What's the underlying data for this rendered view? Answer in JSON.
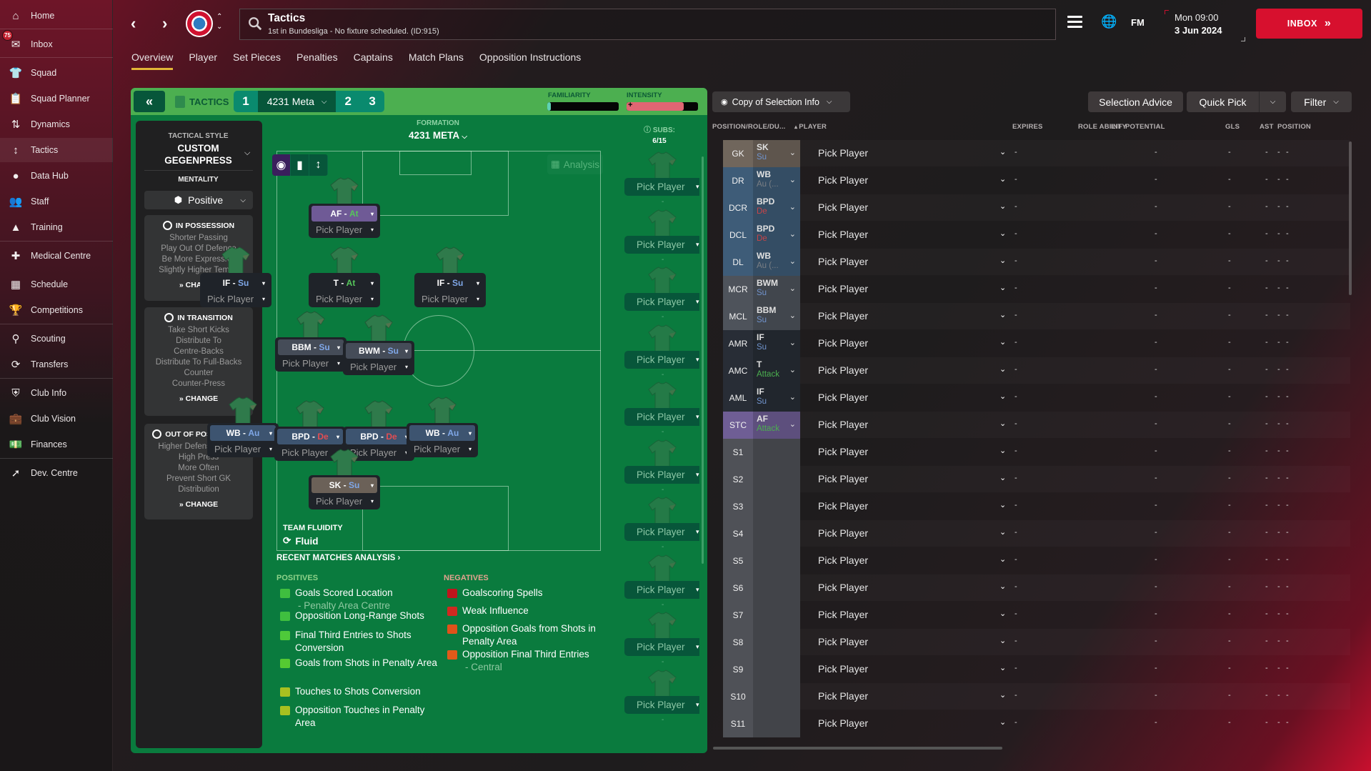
{
  "sidebar": {
    "items": [
      {
        "label": "Home",
        "icon": "home-icon"
      },
      {
        "label": "Inbox",
        "icon": "inbox-icon",
        "badge": "75"
      },
      {
        "label": "Squad",
        "icon": "shirt-icon"
      },
      {
        "label": "Squad Planner",
        "icon": "clipboard-icon"
      },
      {
        "label": "Dynamics",
        "icon": "dynamics-icon"
      },
      {
        "label": "Tactics",
        "icon": "tactics-icon",
        "active": true
      },
      {
        "label": "Data Hub",
        "icon": "data-hub-icon"
      },
      {
        "label": "Staff",
        "icon": "staff-icon"
      },
      {
        "label": "Training",
        "icon": "training-icon"
      },
      {
        "label": "Medical Centre",
        "icon": "medical-icon"
      },
      {
        "label": "Schedule",
        "icon": "calendar-icon"
      },
      {
        "label": "Competitions",
        "icon": "trophy-icon"
      },
      {
        "label": "Scouting",
        "icon": "search-icon"
      },
      {
        "label": "Transfers",
        "icon": "transfer-icon"
      },
      {
        "label": "Club Info",
        "icon": "shield-icon"
      },
      {
        "label": "Club Vision",
        "icon": "briefcase-icon"
      },
      {
        "label": "Finances",
        "icon": "money-icon"
      },
      {
        "label": "Dev. Centre",
        "icon": "growth-icon"
      }
    ]
  },
  "header": {
    "title": "Tactics",
    "subtitle": "1st in Bundesliga - No fixture scheduled. (ID:915)",
    "fm_label": "FM",
    "date_time": "Mon 09:00",
    "date": "3 Jun 2024",
    "inbox_label": "INBOX"
  },
  "tabs": [
    "Overview",
    "Player",
    "Set Pieces",
    "Penalties",
    "Captains",
    "Match Plans",
    "Opposition Instructions"
  ],
  "tactics_bar": {
    "label": "TACTICS",
    "slots": [
      "1",
      "2",
      "3"
    ],
    "active_tactic": "4231 Meta",
    "familiarity_label": "FAMILIARITY",
    "familiarity_value": 0.05,
    "intensity_label": "INTENSITY",
    "intensity_value": 0.8
  },
  "style": {
    "caption": "TACTICAL STYLE",
    "name_line1": "CUSTOM",
    "name_line2": "GEGENPRESS",
    "mentality_caption": "MENTALITY",
    "mentality": "Positive",
    "change_label": "CHANGE",
    "in_possession": {
      "title": "IN POSSESSION",
      "lines": [
        "Shorter Passing",
        "Play Out Of Defence",
        "Be More Expressive",
        "Slightly Higher Tempo"
      ]
    },
    "in_transition": {
      "title": "IN TRANSITION",
      "lines": [
        "Take Short Kicks",
        "Distribute To",
        "Centre-Backs",
        "Distribute To Full-Backs",
        "Counter",
        "Counter-Press"
      ]
    },
    "out_of_possession": {
      "title": "OUT OF POSSESSION",
      "lines": [
        "Higher Defensive Line",
        "High Press",
        "More Often",
        "Prevent Short GK",
        "Distribution"
      ]
    }
  },
  "pitch": {
    "formation_caption": "FORMATION",
    "formation": "4231 META",
    "subs_caption": "SUBS:",
    "subs_count": "6/15",
    "analysis_label": "Analysis",
    "pick_label": "Pick Player",
    "fluidity_caption": "TEAM FLUIDITY",
    "fluidity": "Fluid",
    "players": [
      {
        "role": "AF",
        "duty": "At",
        "duty_class": "at",
        "color": "#6f5a96"
      },
      {
        "role": "IF",
        "duty": "Su",
        "duty_class": "su",
        "color": "#1f2329"
      },
      {
        "role": "T",
        "duty": "At",
        "duty_class": "at",
        "color": "#1f2329"
      },
      {
        "role": "IF",
        "duty": "Su",
        "duty_class": "su",
        "color": "#1f2329"
      },
      {
        "role": "BBM",
        "duty": "Su",
        "duty_class": "su",
        "color": "#454c58"
      },
      {
        "role": "BWM",
        "duty": "Su",
        "duty_class": "su",
        "color": "#454c58"
      },
      {
        "role": "WB",
        "duty": "Au",
        "duty_class": "au",
        "color": "#3d5470"
      },
      {
        "role": "BPD",
        "duty": "De",
        "duty_class": "de",
        "color": "#3d5470"
      },
      {
        "role": "BPD",
        "duty": "De",
        "duty_class": "de",
        "color": "#3d5470"
      },
      {
        "role": "WB",
        "duty": "Au",
        "duty_class": "au",
        "color": "#3d5470"
      },
      {
        "role": "SK",
        "duty": "Su",
        "duty_class": "su",
        "color": "#6b6158"
      }
    ],
    "sub_slots": 10,
    "sub_dash": "-"
  },
  "recent_matches": {
    "title": "RECENT MATCHES ANALYSIS",
    "positives_label": "POSITIVES",
    "negatives_label": "NEGATIVES",
    "positives": [
      {
        "text": "Goals Scored Location",
        "sub": "- Penalty Area Centre",
        "color": "#3fbf3f"
      },
      {
        "text": "Opposition Long-Range Shots",
        "color": "#3fbf3f"
      },
      {
        "text": "Final Third Entries to Shots Conversion",
        "color": "#4ec93a"
      },
      {
        "text": "Goals from Shots in Penalty Area",
        "color": "#55c932"
      },
      {
        "text": "Touches to Shots Conversion",
        "color": "#a8c020"
      },
      {
        "text": "Opposition Touches in Penalty Area",
        "color": "#a8c020"
      }
    ],
    "negatives": [
      {
        "text": "Goalscoring Spells",
        "color": "#c0141c"
      },
      {
        "text": "Weak Influence",
        "color": "#d02a20"
      },
      {
        "text": "Opposition Goals from Shots in Penalty Area",
        "color": "#e0521a"
      },
      {
        "text": "Opposition Final Third Entries",
        "sub": "- Central",
        "color": "#e05a1a"
      }
    ]
  },
  "selection": {
    "copy_label": "Copy of Selection Info",
    "advice_label": "Selection Advice",
    "quick_pick_label": "Quick Pick",
    "filter_label": "Filter",
    "columns": [
      "POSITION/ROLE/DU...",
      "PLAYER",
      "EXPIRES",
      "ROLE ABILITY",
      "INF",
      "POTENTIAL",
      "GLS",
      "AST",
      "POSITION"
    ],
    "pick_label": "Pick Player",
    "empty": "-",
    "rows": [
      {
        "pos": "GK",
        "role": "SK",
        "duty": "Su",
        "duty_color": "#7fa7e8",
        "bg": "#6b6158"
      },
      {
        "pos": "DR",
        "role": "WB",
        "duty": "Au (...",
        "duty_color": "#8a8f96",
        "bg": "#3b5872"
      },
      {
        "pos": "DCR",
        "role": "BPD",
        "duty": "De",
        "duty_color": "#e34d52",
        "bg": "#3b5872"
      },
      {
        "pos": "DCL",
        "role": "BPD",
        "duty": "De",
        "duty_color": "#e34d52",
        "bg": "#3b5872"
      },
      {
        "pos": "DL",
        "role": "WB",
        "duty": "Au (...",
        "duty_color": "#8a8f96",
        "bg": "#3b5872"
      },
      {
        "pos": "MCR",
        "role": "BWM",
        "duty": "Su",
        "duty_color": "#7fa7e8",
        "bg": "#4a4f57"
      },
      {
        "pos": "MCL",
        "role": "BBM",
        "duty": "Su",
        "duty_color": "#7fa7e8",
        "bg": "#4a4f57"
      },
      {
        "pos": "AMR",
        "role": "IF",
        "duty": "Su",
        "duty_color": "#7fa7e8",
        "bg": "#262b33"
      },
      {
        "pos": "AMC",
        "role": "T",
        "duty": "Attack",
        "duty_color": "#55c65a",
        "bg": "#262b33"
      },
      {
        "pos": "AML",
        "role": "IF",
        "duty": "Su",
        "duty_color": "#7fa7e8",
        "bg": "#262b33"
      },
      {
        "pos": "STC",
        "role": "AF",
        "duty": "Attack",
        "duty_color": "#55c65a",
        "bg": "#6a5a8e"
      },
      {
        "pos": "S1",
        "role": "",
        "duty": "",
        "bg": "#4b4d53"
      },
      {
        "pos": "S2",
        "role": "",
        "duty": "",
        "bg": "#4b4d53"
      },
      {
        "pos": "S3",
        "role": "",
        "duty": "",
        "bg": "#4b4d53"
      },
      {
        "pos": "S4",
        "role": "",
        "duty": "",
        "bg": "#4b4d53"
      },
      {
        "pos": "S5",
        "role": "",
        "duty": "",
        "bg": "#4b4d53"
      },
      {
        "pos": "S6",
        "role": "",
        "duty": "",
        "bg": "#4b4d53"
      },
      {
        "pos": "S7",
        "role": "",
        "duty": "",
        "bg": "#4b4d53"
      },
      {
        "pos": "S8",
        "role": "",
        "duty": "",
        "bg": "#4b4d53"
      },
      {
        "pos": "S9",
        "role": "",
        "duty": "",
        "bg": "#4b4d53"
      },
      {
        "pos": "S10",
        "role": "",
        "duty": "",
        "bg": "#4b4d53"
      },
      {
        "pos": "S11",
        "role": "",
        "duty": "",
        "bg": "#4b4d53"
      }
    ]
  },
  "colors": {
    "accent": "#d7102e",
    "tab_underline": "#e2b637",
    "pitch": "#0a7b3e",
    "tactics_bar": "#4caf50"
  }
}
